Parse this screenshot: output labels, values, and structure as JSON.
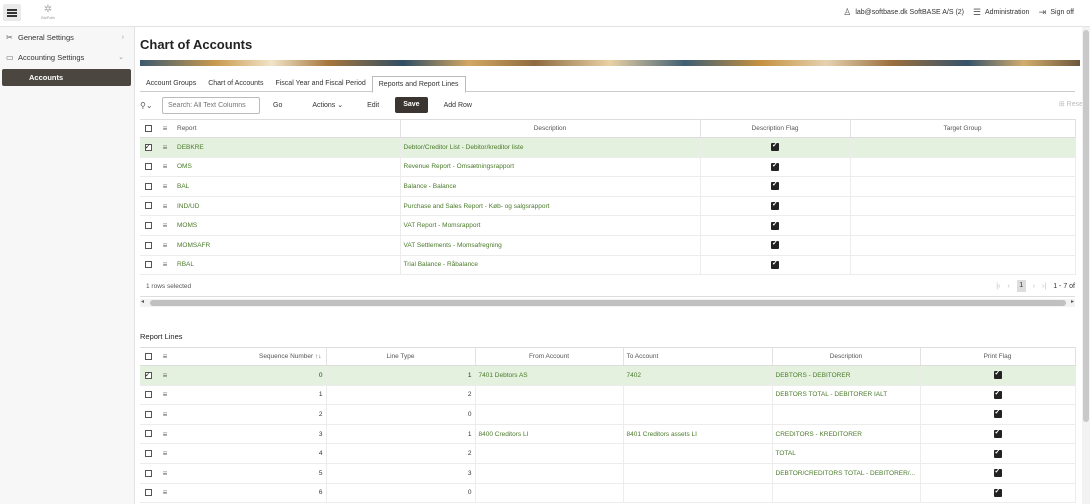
{
  "header": {
    "logo_text": "BizPath",
    "user": "lab@softbase.dk SoftBASE A/S (2)",
    "administration": "Administration",
    "signoff": "Sign off"
  },
  "sidebar": {
    "items": [
      {
        "label": "General Settings"
      },
      {
        "label": "Accounting Settings"
      },
      {
        "label": "Accounts"
      }
    ]
  },
  "page": {
    "title": "Chart of Accounts",
    "tabs": [
      "Account Groups",
      "Chart of Accounts",
      "Fiscal Year and Fiscal Period",
      "Reports and Report Lines"
    ],
    "active_tab": "Reports and Report Lines"
  },
  "toolbar": {
    "search_placeholder": "Search: All Text Columns",
    "go": "Go",
    "actions": "Actions",
    "edit": "Edit",
    "save": "Save",
    "add_row": "Add Row",
    "reset": "Rese"
  },
  "reports_grid": {
    "columns": [
      "Report",
      "Description",
      "Description Flag",
      "Target Group"
    ],
    "rows": [
      {
        "report": "DEBKRE",
        "description": "Debtor/Creditor List - Debitor/kreditor liste",
        "flag": true,
        "target": "",
        "selected": true
      },
      {
        "report": "OMS",
        "description": "Revenue Report - Omsætningsrapport",
        "flag": true,
        "target": "",
        "selected": false
      },
      {
        "report": "BAL",
        "description": "Balance - Balance",
        "flag": true,
        "target": "",
        "selected": false
      },
      {
        "report": "IND/UD",
        "description": "Purchase and Sales Report - Køb- og salgsrapport",
        "flag": true,
        "target": "",
        "selected": false
      },
      {
        "report": "MOMS",
        "description": "VAT Report - Momsrapport",
        "flag": true,
        "target": "",
        "selected": false
      },
      {
        "report": "MOMSAFR",
        "description": "VAT Settlements - Momsafregning",
        "flag": true,
        "target": "",
        "selected": false
      },
      {
        "report": "RBAL",
        "description": "Trial Balance - Råbalance",
        "flag": true,
        "target": "",
        "selected": false
      }
    ],
    "rows_selected": "1 rows selected",
    "page": "1",
    "range": "1 - 7 of"
  },
  "report_lines": {
    "title": "Report Lines",
    "columns": [
      "Sequence Number",
      "Line Type",
      "From Account",
      "To Account",
      "Description",
      "Print Flag"
    ],
    "rows": [
      {
        "seq": "0",
        "type": "1",
        "from": "7401 Debtors AS",
        "to": "7402",
        "description": "DEBTORS - DEBITORER",
        "print": true,
        "selected": true
      },
      {
        "seq": "1",
        "type": "2",
        "from": "",
        "to": "",
        "description": "DEBTORS TOTAL - DEBITORER IALT",
        "print": true,
        "selected": false
      },
      {
        "seq": "2",
        "type": "0",
        "from": "",
        "to": "",
        "description": "",
        "print": true,
        "selected": false
      },
      {
        "seq": "3",
        "type": "1",
        "from": "8400 Creditors LI",
        "to": "8401 Creditors assets LI",
        "description": "CREDITORS - KREDITORER",
        "print": true,
        "selected": false
      },
      {
        "seq": "4",
        "type": "2",
        "from": "",
        "to": "",
        "description": "TOTAL",
        "print": true,
        "selected": false
      },
      {
        "seq": "5",
        "type": "3",
        "from": "",
        "to": "",
        "description": "DEBTOR/CREDITORS TOTAL - DEBITORER/...",
        "print": true,
        "selected": false
      },
      {
        "seq": "6",
        "type": "0",
        "from": "",
        "to": "",
        "description": "",
        "print": true,
        "selected": false
      }
    ]
  }
}
